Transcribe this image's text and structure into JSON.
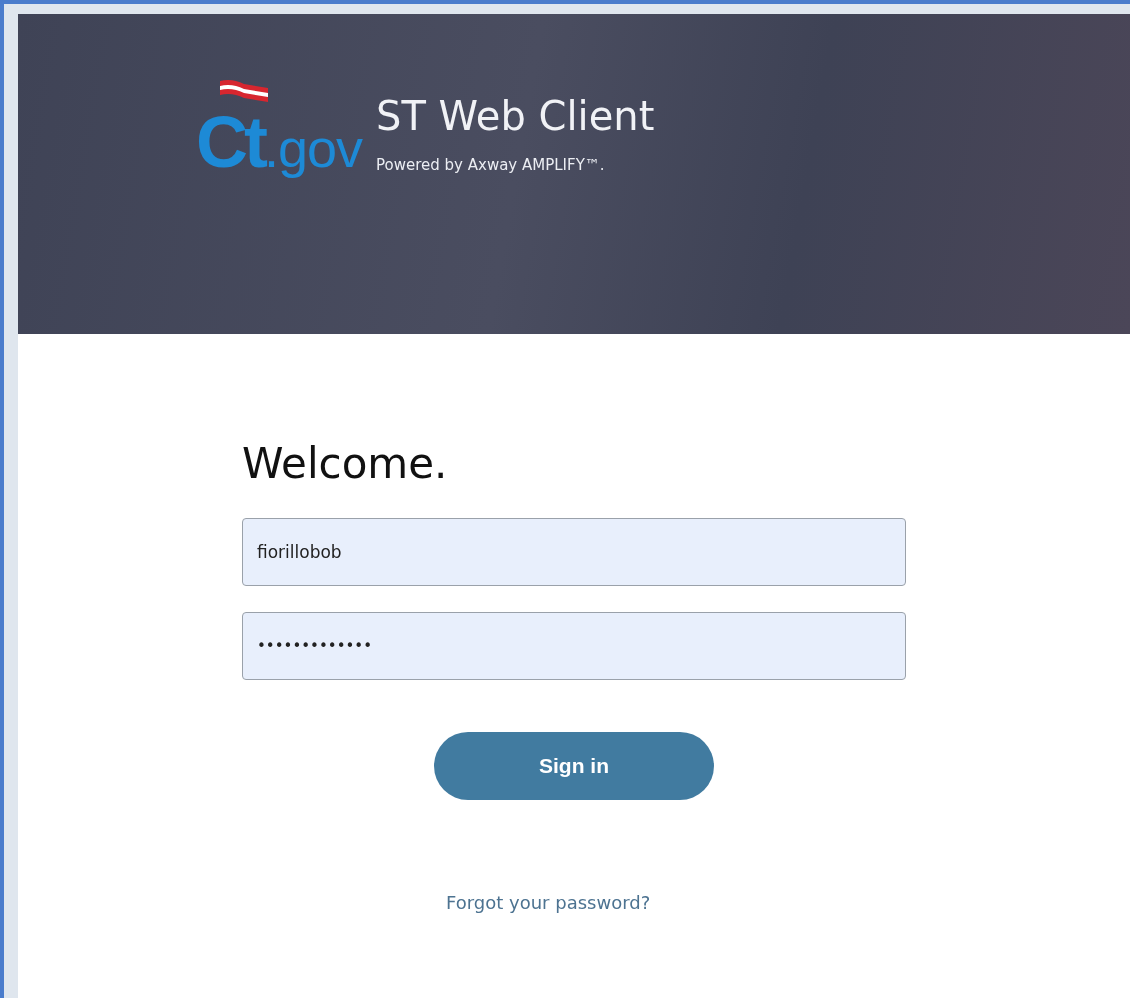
{
  "header": {
    "logo": {
      "mark": "Ct",
      "suffix": ".gov"
    },
    "title": "ST Web Client",
    "subtitle": "Powered by Axway AMPLIFY™."
  },
  "form": {
    "heading": "Welcome.",
    "fields": [
      {
        "kind": "text",
        "value": "fiorillobob"
      },
      {
        "kind": "password",
        "value": "•••••••••••••"
      }
    ],
    "submit": "Sign in",
    "forgot_link": "Forgot your password?"
  }
}
